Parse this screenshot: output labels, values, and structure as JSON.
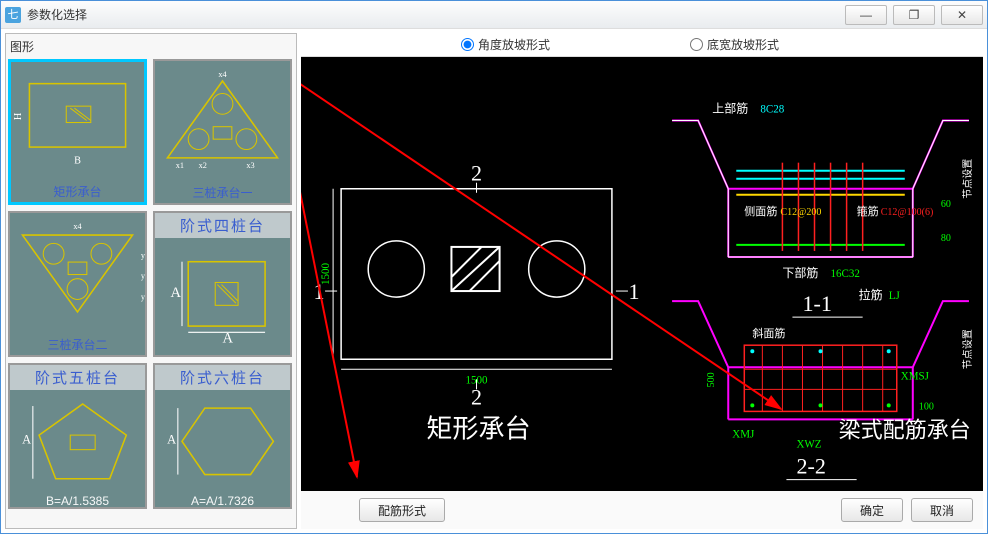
{
  "window": {
    "title": "参数化选择"
  },
  "winbtns": {
    "min": "—",
    "max": "❐",
    "close": "✕"
  },
  "sidebar": {
    "heading": "图形",
    "items": [
      {
        "caption": "矩形承台",
        "type": "rect",
        "selected": true
      },
      {
        "caption": "三桩承台一",
        "type": "tri1"
      },
      {
        "caption": "三桩承台二",
        "type": "tri2"
      },
      {
        "caption": "阶式四桩台",
        "type": "step4"
      },
      {
        "caption": "阶式五桩台",
        "type": "step5",
        "sub": "B=A/1.5385"
      },
      {
        "caption": "阶式六桩台",
        "type": "step6",
        "sub": "A=A/1.7326"
      }
    ]
  },
  "radios": {
    "angle": "角度放坡形式",
    "width": "底宽放坡形式",
    "selected": "angle"
  },
  "viewer": {
    "left_label_main": "矩形承台",
    "right_label_main": "梁式配筋承台",
    "dim_h": "1500",
    "dim_v": "1500",
    "mark1": "1",
    "mark2": "2",
    "section11": "1-1",
    "section22": "2-2",
    "upper_rebar_label": "上部筋",
    "upper_rebar_val": "8C28",
    "side_rebar_label": "侧面筋",
    "side_rebar_val": "C12@200",
    "stirrup_label": "箍筋",
    "stirrup_val": "C12@100(6)",
    "lower_rebar_label": "下部筋",
    "lower_rebar_val": "16C32",
    "tie_label": "拉筋",
    "tie_val": "LJ",
    "diag_label": "斜面筋",
    "xmj": "XMJ",
    "xmsj": "XMSJ",
    "xwz": "XWZ",
    "num60": "60",
    "num80": "80",
    "num500": "500",
    "num100": "100",
    "dist_label": "节点设置"
  },
  "buttons": {
    "rebar_form": "配筋形式",
    "ok": "确定",
    "cancel": "取消"
  }
}
